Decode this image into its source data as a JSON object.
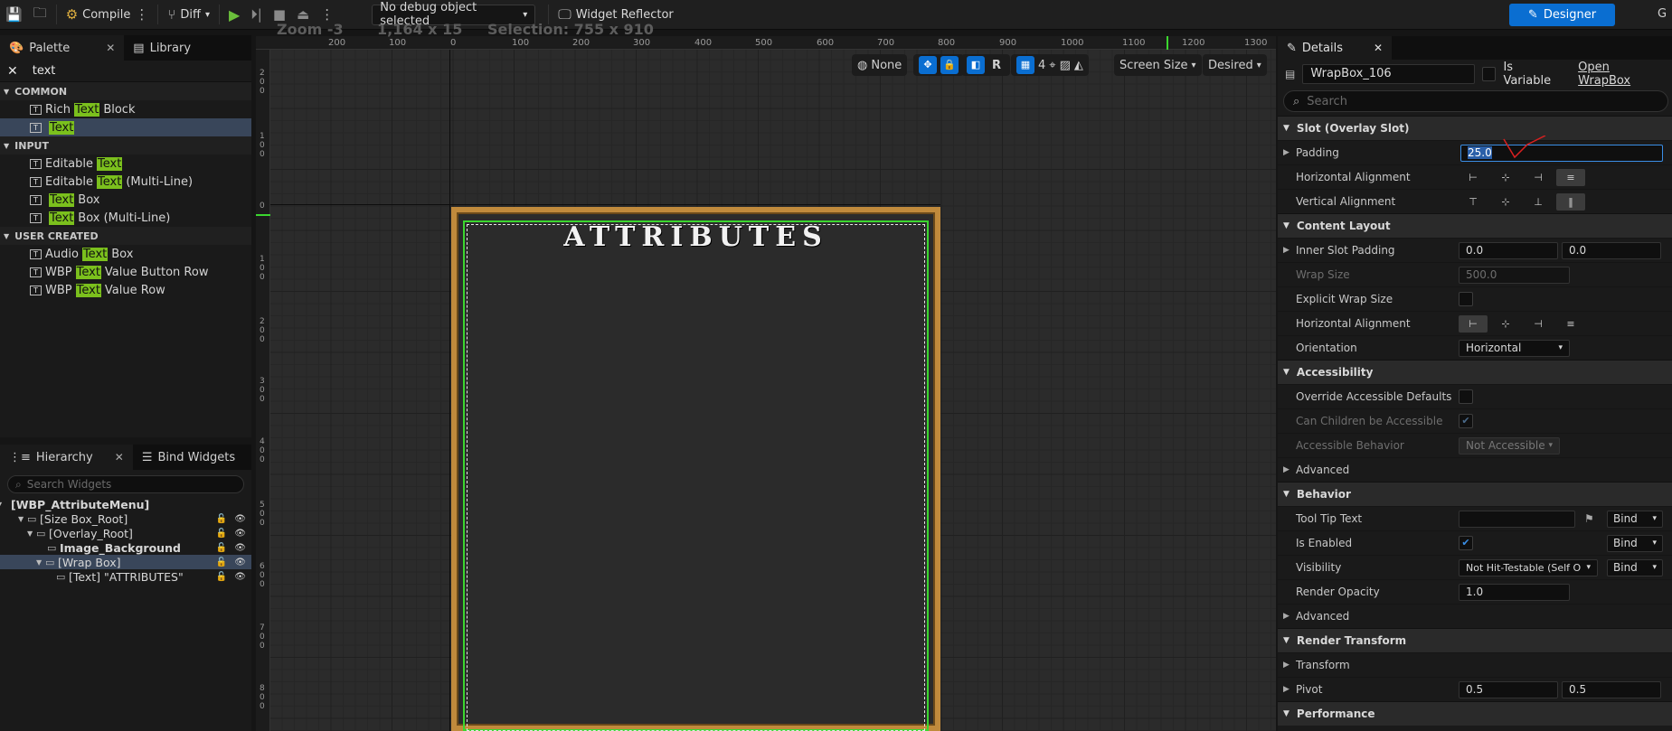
{
  "toolbar": {
    "compile_label": "Compile",
    "diff_label": "Diff",
    "debug_object": "No debug object selected",
    "widget_reflector_label": "Widget Reflector",
    "designer_label": "Designer",
    "g_label": "G"
  },
  "palette": {
    "tab_label": "Palette",
    "library_tab_label": "Library",
    "search_value": "text",
    "categories": [
      {
        "label": "COMMON",
        "items": [
          {
            "pre": "Rich ",
            "hl": "Text",
            "post": " Block"
          },
          {
            "pre": "",
            "hl": "Text",
            "post": ""
          }
        ]
      },
      {
        "label": "INPUT",
        "items": [
          {
            "pre": "Editable ",
            "hl": "Text",
            "post": ""
          },
          {
            "pre": "Editable ",
            "hl": "Text",
            "post": " (Multi-Line)"
          },
          {
            "pre": "",
            "hl": "Text",
            "post": " Box"
          },
          {
            "pre": "",
            "hl": "Text",
            "post": " Box (Multi-Line)"
          }
        ]
      },
      {
        "label": "USER CREATED",
        "items": [
          {
            "pre": "Audio ",
            "hl": "Text",
            "post": " Box"
          },
          {
            "pre": "WBP ",
            "hl": "Text",
            "post": " Value Button Row"
          },
          {
            "pre": "WBP ",
            "hl": "Text",
            "post": " Value Row"
          }
        ]
      }
    ]
  },
  "hierarchy": {
    "tab_label": "Hierarchy",
    "bind_tab_label": "Bind Widgets",
    "search_placeholder": "Search Widgets",
    "items": [
      {
        "label": "[WBP_AttributeMenu]"
      },
      {
        "label": "[Size Box_Root]"
      },
      {
        "label": "[Overlay_Root]"
      },
      {
        "label": "Image_Background"
      },
      {
        "label": "[Wrap Box]"
      },
      {
        "label": "[Text] \"ATTRIBUTES\""
      }
    ]
  },
  "viewport": {
    "zoom": "Zoom -3",
    "resolution": "1,164 x 15",
    "selection": "Selection: 755 x 910",
    "none_label": "None",
    "r_label": "R",
    "grid_num": "4",
    "screen_size_label": "Screen Size",
    "desired_label": "Desired",
    "ruler_top": [
      "200",
      "100",
      "0",
      "100",
      "200",
      "300",
      "400",
      "500",
      "600",
      "700",
      "800",
      "900",
      "1000",
      "1100",
      "1200",
      "1300"
    ],
    "ruler_left": [
      [
        "2",
        "0",
        "0"
      ],
      [
        "1",
        "0",
        "0"
      ],
      [
        "0"
      ],
      [
        "1",
        "0",
        "0"
      ],
      [
        "2",
        "0",
        "0"
      ],
      [
        "3",
        "0",
        "0"
      ],
      [
        "4",
        "0",
        "0"
      ],
      [
        "5",
        "0",
        "0"
      ],
      [
        "6",
        "0",
        "0"
      ],
      [
        "7",
        "0",
        "0"
      ],
      [
        "8",
        "0",
        "0"
      ]
    ],
    "canvas_title": "ATTRIBUTES"
  },
  "details": {
    "tab_label": "Details",
    "widget_name": "WrapBox_106",
    "is_variable_label": "Is Variable",
    "open_label": "Open WrapBox",
    "search_placeholder": "Search",
    "slot_section": "Slot (Overlay Slot)",
    "padding_label": "Padding",
    "padding_value": "25.0",
    "h_align_label": "Horizontal Alignment",
    "v_align_label": "Vertical Alignment",
    "content_section": "Content Layout",
    "inner_padding_label": "Inner Slot Padding",
    "inner_padding_x": "0.0",
    "inner_padding_y": "0.0",
    "wrap_size_label": "Wrap Size",
    "wrap_size_value": "500.0",
    "explicit_wrap_label": "Explicit Wrap Size",
    "content_h_align_label": "Horizontal Alignment",
    "orientation_label": "Orientation",
    "orientation_value": "Horizontal",
    "access_section": "Accessibility",
    "override_label": "Override Accessible Defaults",
    "children_label": "Can Children be Accessible",
    "behavior_access_label": "Accessible Behavior",
    "behavior_access_value": "Not Accessible",
    "advanced_label": "Advanced",
    "behavior_section": "Behavior",
    "tooltip_label": "Tool Tip Text",
    "bind_label": "Bind",
    "enabled_label": "Is Enabled",
    "visibility_label": "Visibility",
    "visibility_value": "Not Hit-Testable (Self O",
    "opacity_label": "Render Opacity",
    "opacity_value": "1.0",
    "advanced2_label": "Advanced",
    "render_section": "Render Transform",
    "transform_label": "Transform",
    "pivot_label": "Pivot",
    "pivot_x": "0.5",
    "pivot_y": "0.5",
    "perf_section": "Performance"
  }
}
